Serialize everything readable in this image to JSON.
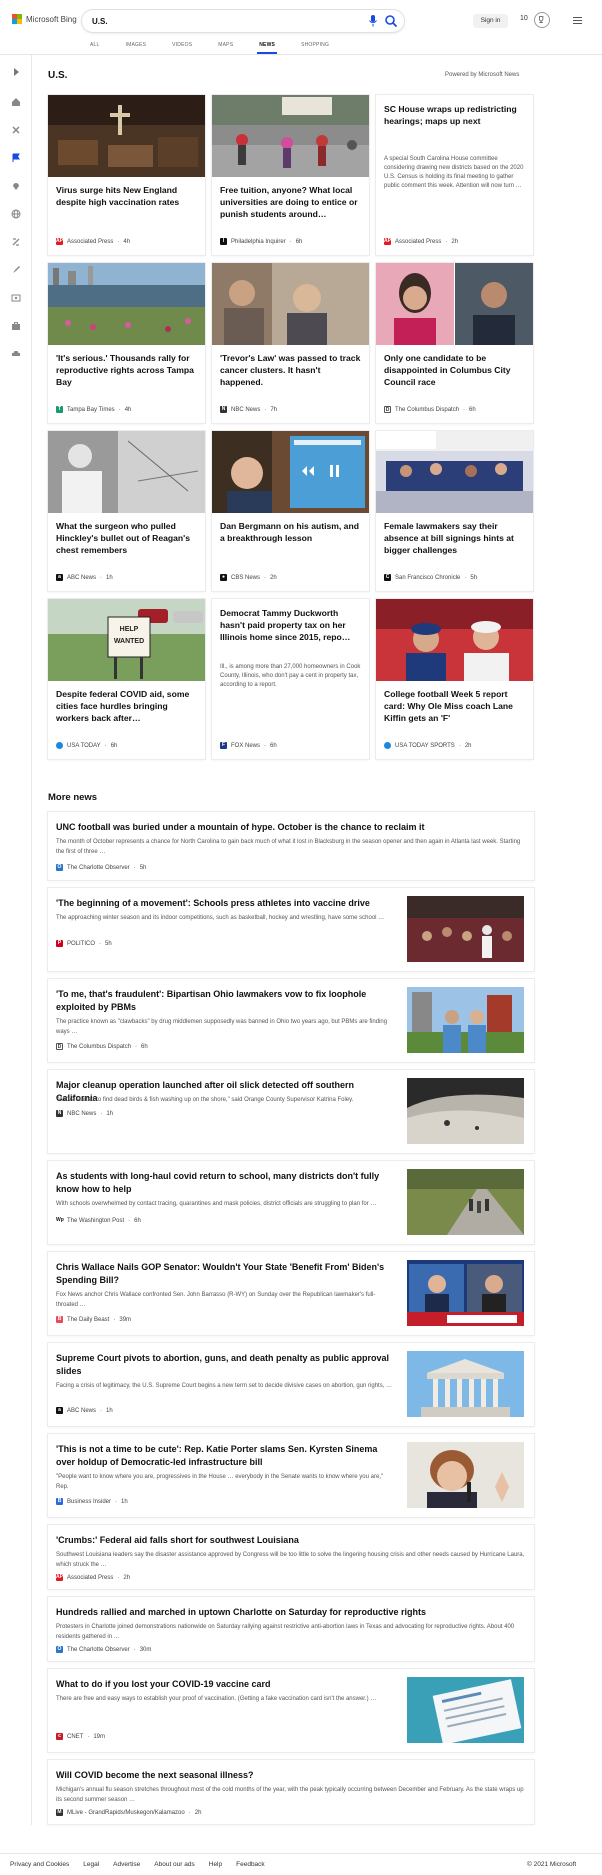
{
  "header": {
    "logo_text": "Microsoft Bing",
    "search_value": "U.S.",
    "signin": "Sign in",
    "points": "10",
    "tabs": [
      "ALL",
      "IMAGES",
      "VIDEOS",
      "MAPS",
      "NEWS",
      "SHOPPING"
    ],
    "active_tab": "NEWS"
  },
  "section": {
    "title": "U.S.",
    "powered_by": "Powered by Microsoft News"
  },
  "cards": [
    {
      "title": "Virus surge hits New England despite high vaccination rates",
      "source": "Associated Press",
      "time": "4h"
    },
    {
      "title": "Free tuition, anyone? What local universities are doing to entice or punish students around…",
      "source": "Philadelphia Inquirer",
      "time": "6h"
    },
    {
      "title": "SC House wraps up redistricting hearings; maps up next",
      "snippet": "A special South Carolina House committee considering drawing new districts based on the 2020 U.S. Census is holding its final meeting to gather public comment this week. Attention will now turn …",
      "source": "Associated Press",
      "time": "2h"
    },
    {
      "title": "'It's serious.' Thousands rally for reproductive rights across Tampa Bay",
      "source": "Tampa Bay Times",
      "time": "4h"
    },
    {
      "title": "'Trevor's Law' was passed to track cancer clusters. It hasn't happened.",
      "source": "NBC News",
      "time": "7h"
    },
    {
      "title": "Only one candidate to be disappointed in Columbus City Council race",
      "source": "The Columbus Dispatch",
      "time": "6h"
    },
    {
      "title": "What the surgeon who pulled Hinckley's bullet out of Reagan's chest remembers",
      "source": "ABC News",
      "time": "1h"
    },
    {
      "title": "Dan Bergmann on his autism, and a breakthrough lesson",
      "source": "CBS News",
      "time": "2h"
    },
    {
      "title": "Female lawmakers say their absence at bill signings hints at bigger challenges",
      "source": "San Francisco Chronicle",
      "time": "5h"
    },
    {
      "title": "Despite federal COVID aid, some cities face hurdles bringing workers back after…",
      "source": "USA TODAY",
      "time": "6h"
    },
    {
      "title": "Democrat Tammy Duckworth hasn't paid property tax on her Illinois home since 2015, repo…",
      "snippet": "Ill., is among more than 27,000 homeowners in Cook County, Illinois, who don't pay a cent in property tax, according to a report.",
      "source": "FOX News",
      "time": "6h"
    },
    {
      "title": "College football Week 5 report card: Why Ole Miss coach Lane Kiffin gets an 'F'",
      "source": "USA TODAY SPORTS",
      "time": "2h"
    }
  ],
  "more_news_title": "More news",
  "more_news": [
    {
      "title": "UNC football was buried under a mountain of hype. October is the chance to reclaim it",
      "snippet": "The month of October represents a chance for North Carolina to gain back much of what it lost in Blacksburg in the season opener and then again in Atlanta last week. Starting the first of three …",
      "source": "The Charlotte Observer",
      "time": "5h"
    },
    {
      "title": "'The beginning of a movement': Schools press athletes into vaccine drive",
      "snippet": "The approaching winter season and its indoor competitions, such as basketball, hockey and wrestling, have some school …",
      "source": "POLITICO",
      "time": "5h"
    },
    {
      "title": "'To me, that's fraudulent': Bipartisan Ohio lawmakers vow to fix loophole exploited by PBMs",
      "snippet": "The practice known as \"clawbacks\" by drug middlemen supposedly was banned in Ohio two years ago, but PBMs are finding ways …",
      "source": "The Columbus Dispatch",
      "time": "6h"
    },
    {
      "title": "Major cleanup operation launched after oil slick detected off southern California",
      "snippet": "\"We've started to find dead birds & fish washing up on the shore,\" said Orange County Supervisor Katrina Foley.",
      "source": "NBC News",
      "time": "1h"
    },
    {
      "title": "As students with long-haul covid return to school, many districts don't fully know how to help",
      "snippet": "With schools overwhelmed by contact tracing, quarantines and mask policies, district officials are struggling to plan for …",
      "source": "The Washington Post",
      "time": "6h"
    },
    {
      "title": "Chris Wallace Nails GOP Senator: Wouldn't Your State 'Benefit From' Biden's Spending Bill?",
      "snippet": "Fox News anchor Chris Wallace confronted Sen. John Barrasso (R-WY) on Sunday over the Republican lawmaker's full-throated …",
      "source": "The Daily Beast",
      "time": "39m"
    },
    {
      "title": "Supreme Court pivots to abortion, guns, and death penalty as public approval slides",
      "snippet": "Facing a crisis of legitimacy, the U.S. Supreme Court begins a new term set to decide divisive cases on abortion, gun rights, …",
      "source": "ABC News",
      "time": "1h"
    },
    {
      "title": "'This is not a time to be cute': Rep. Katie Porter slams Sen. Kyrsten Sinema over holdup of Democratic-led infrastructure bill",
      "snippet": "\"People want to know where you are, progressives in the House … everybody in the Senate wants to know where you are,\" Rep.",
      "source": "Business Insider",
      "time": "1h"
    },
    {
      "title": "'Crumbs:' Federal aid falls short for southwest Louisiana",
      "snippet": "Southwest Louisiana leaders say the disaster assistance approved by Congress will be too little to solve the lingering housing crisis and other needs caused by Hurricane Laura, which struck the …",
      "source": "Associated Press",
      "time": "2h"
    },
    {
      "title": "Hundreds rallied and marched in uptown Charlotte on Saturday for reproductive rights",
      "snippet": "Protesters in Charlotte joined demonstrations nationwide on Saturday rallying against restrictive anti-abortion laws in Texas and advocating for reproductive rights. About 400 residents gathered in …",
      "source": "The Charlotte Observer",
      "time": "30m"
    },
    {
      "title": "What to do if you lost your COVID-19 vaccine card",
      "snippet": "There are free and easy ways to establish your proof of vaccination. (Getting a fake vaccination card isn't the answer.) …",
      "source": "CNET",
      "time": "19m"
    },
    {
      "title": "Will COVID become the next seasonal illness?",
      "snippet": "Michigan's annual flu season stretches throughout most of the cold months of the year, with the peak typically occurring between December and February. As the state wraps up its second summer season …",
      "source": "MLive - GrandRapids/Muskegon/Kalamazoo",
      "time": "2h"
    }
  ],
  "footer": {
    "links": [
      "Privacy and Cookies",
      "Legal",
      "Advertise",
      "About our ads",
      "Help",
      "Feedback"
    ],
    "copyright": "© 2021 Microsoft"
  }
}
